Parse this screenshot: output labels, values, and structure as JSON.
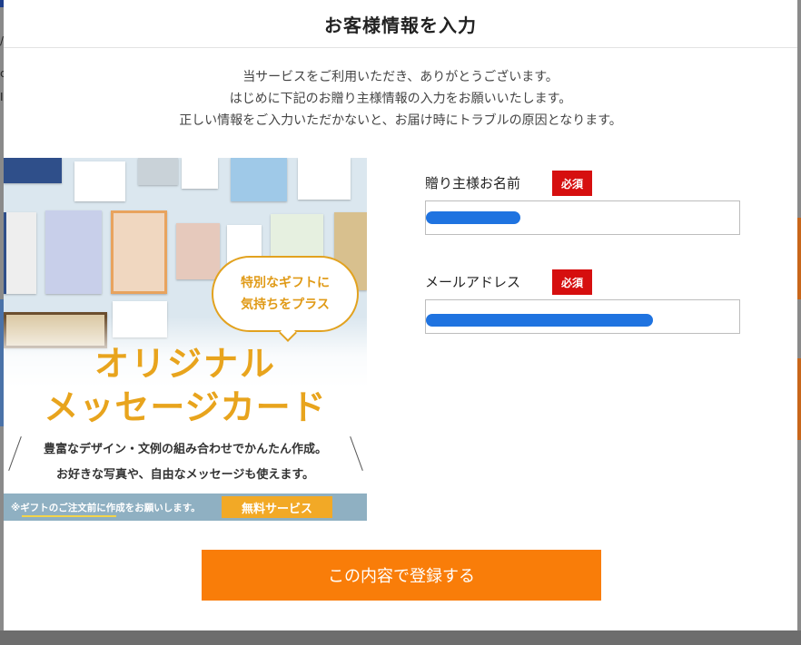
{
  "modal": {
    "title": "お客様情報を入力",
    "intro_lines": [
      "当サービスをご利用いただき、ありがとうございます。",
      "はじめに下記のお贈り主様情報の入力をお願いいたします。",
      "正しい情報をご入力いただかないと、お届け時にトラブルの原因となります。"
    ]
  },
  "banner": {
    "bubble_line1": "特別なギフトに",
    "bubble_line2": "気持ちをプラス",
    "headline1": "オリジナル",
    "headline2": "メッセージカード",
    "sub1": "豊富なデザイン・文例の組み合わせでかんたん作成。",
    "sub2": "お好きな写真や、自由なメッセージも使えます。",
    "footnote": "※ギフトのご注文前に作成をお願いします。",
    "badge": "無料サービス"
  },
  "form": {
    "sender_name_label": "贈り主様お名前",
    "email_label": "メールアドレス",
    "required_badge": "必須",
    "submit_label": "この内容で登録する"
  },
  "colors": {
    "submit": "#f97d09",
    "required": "#d60f0f",
    "banner_accent": "#e8a41d",
    "redaction": "#1f73e0"
  }
}
